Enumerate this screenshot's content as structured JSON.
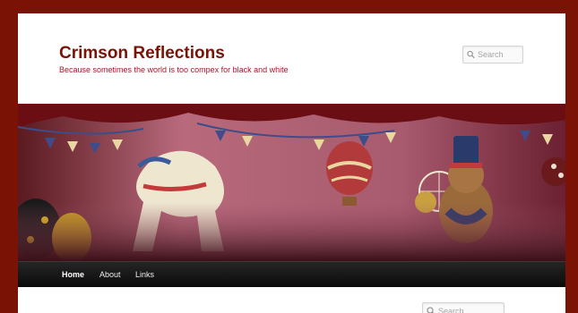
{
  "header": {
    "site_title": "Crimson Reflections",
    "site_description": "Because sometimes the world is too compex for black and white"
  },
  "header_search": {
    "placeholder": "Search",
    "icon": "search-icon"
  },
  "banner": {
    "icon": "banner-image"
  },
  "nav": {
    "items": [
      {
        "label": "Home",
        "active": true
      },
      {
        "label": "About",
        "active": false
      },
      {
        "label": "Links",
        "active": false
      }
    ]
  },
  "sidebar_search": {
    "placeholder": "Search",
    "icon": "search-icon"
  },
  "colors": {
    "frame_background": "#7a1305",
    "title": "#7a1305",
    "description": "#a0182a",
    "nav_background": "#111111"
  }
}
